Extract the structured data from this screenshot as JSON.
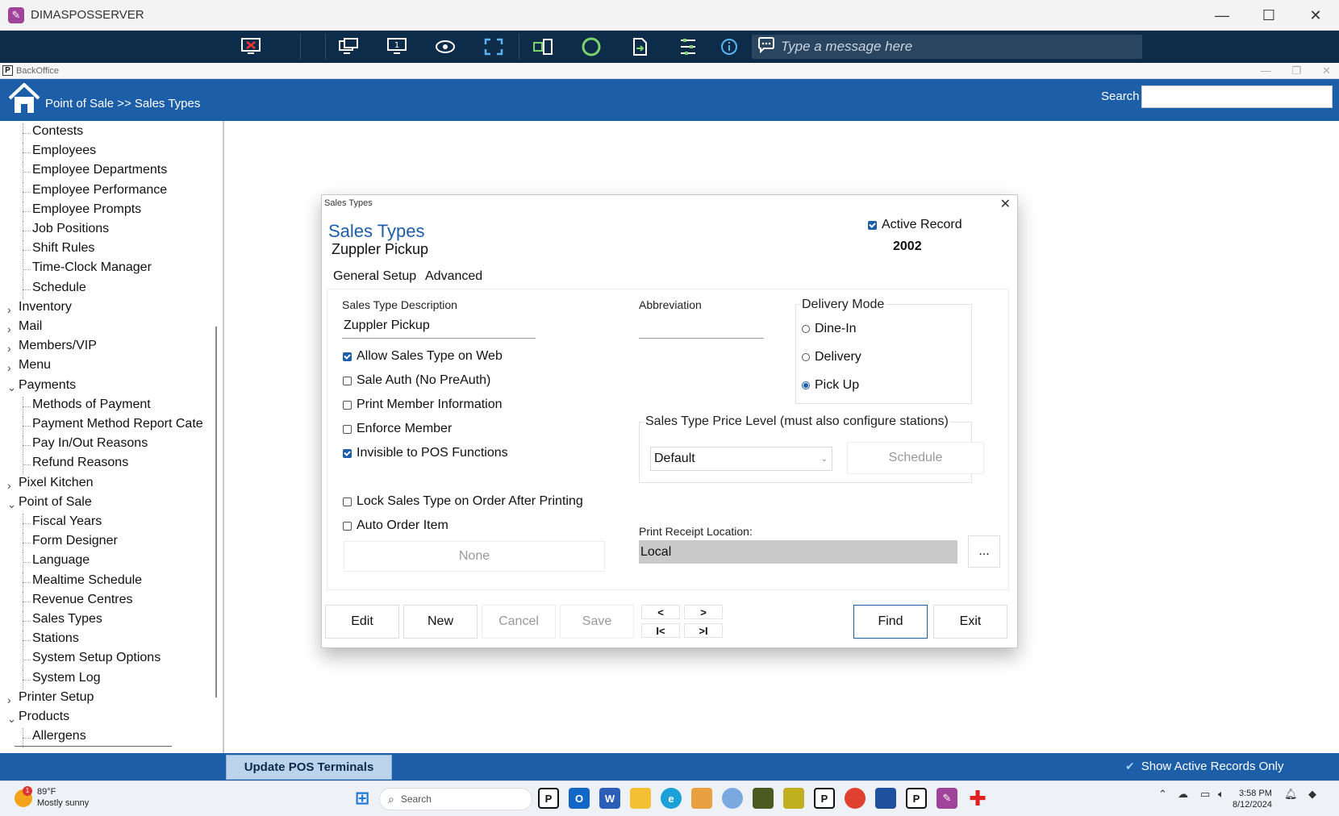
{
  "window": {
    "title": "DIMASPOSSERVER",
    "controls": [
      "—",
      "☐",
      "✕"
    ]
  },
  "remote_toolbar": {
    "icons": [
      "disconnect-icon",
      "monitor-swap-icon",
      "monitor-one-icon",
      "view-icon",
      "fullscreen-icon",
      "transfer-icon",
      "record-icon",
      "file-transfer-icon",
      "settings-list-icon",
      "info-icon"
    ],
    "message_placeholder": "Type a message here"
  },
  "backoffice_bar": {
    "title": "BackOffice",
    "logo": "P"
  },
  "header": {
    "breadcrumb": "Point of Sale >> Sales Types",
    "search_label": "Search",
    "search_value": ""
  },
  "sidebar": {
    "items": [
      {
        "label": "Contests",
        "level": 1
      },
      {
        "label": "Employees",
        "level": 1
      },
      {
        "label": "Employee Departments",
        "level": 1
      },
      {
        "label": "Employee Performance",
        "level": 1
      },
      {
        "label": "Employee Prompts",
        "level": 1
      },
      {
        "label": "Job Positions",
        "level": 1
      },
      {
        "label": "Shift Rules",
        "level": 1
      },
      {
        "label": "Time-Clock Manager",
        "level": 1
      },
      {
        "label": "Schedule",
        "level": 1
      },
      {
        "label": "Inventory",
        "level": 0,
        "expand": ">"
      },
      {
        "label": "Mail",
        "level": 0,
        "expand": ">"
      },
      {
        "label": "Members/VIP",
        "level": 0,
        "expand": ">"
      },
      {
        "label": "Menu",
        "level": 0,
        "expand": ">"
      },
      {
        "label": "Payments",
        "level": 0,
        "expand": "v"
      },
      {
        "label": "Methods of Payment",
        "level": 1
      },
      {
        "label": "Payment Method Report Cate",
        "level": 1
      },
      {
        "label": "Pay In/Out Reasons",
        "level": 1
      },
      {
        "label": "Refund Reasons",
        "level": 1
      },
      {
        "label": "Pixel Kitchen",
        "level": 0,
        "expand": ">"
      },
      {
        "label": "Point of Sale",
        "level": 0,
        "expand": "v"
      },
      {
        "label": "Fiscal Years",
        "level": 1
      },
      {
        "label": "Form Designer",
        "level": 1
      },
      {
        "label": "Language",
        "level": 1
      },
      {
        "label": "Mealtime Schedule",
        "level": 1
      },
      {
        "label": "Revenue Centres",
        "level": 1
      },
      {
        "label": "Sales Types",
        "level": 1
      },
      {
        "label": "Stations",
        "level": 1
      },
      {
        "label": "System Setup Options",
        "level": 1
      },
      {
        "label": "System Log",
        "level": 1
      },
      {
        "label": "Printer Setup",
        "level": 0,
        "expand": ">"
      },
      {
        "label": "Products",
        "level": 0,
        "expand": "v"
      },
      {
        "label": "Allergens",
        "level": 1
      }
    ]
  },
  "dialog": {
    "window_title": "Sales Types",
    "heading": "Sales Types",
    "record_name": "Zuppler Pickup",
    "active_record_label": "Active Record",
    "active_record_checked": true,
    "record_id": "2002",
    "tabs": [
      "General Setup",
      "Advanced"
    ],
    "description_label": "Sales Type Description",
    "description_value": "Zuppler Pickup",
    "abbreviation_label": "Abbreviation",
    "abbreviation_value": "",
    "checkboxes": [
      {
        "label": "Allow Sales Type on Web",
        "checked": true
      },
      {
        "label": "Sale Auth (No PreAuth)",
        "checked": false
      },
      {
        "label": "Print Member Information",
        "checked": false
      },
      {
        "label": "Enforce Member",
        "checked": false
      },
      {
        "label": "Invisible to POS Functions",
        "checked": true
      },
      {
        "label": "Lock Sales Type on Order After Printing",
        "checked": false
      },
      {
        "label": "Auto Order Item",
        "checked": false
      }
    ],
    "auto_order_item_value": "None",
    "delivery_mode": {
      "title": "Delivery Mode",
      "options": [
        "Dine-In",
        "Delivery",
        "Pick Up"
      ],
      "selected": "Pick Up"
    },
    "price_level": {
      "title": "Sales Type Price Level (must also configure stations)",
      "selected": "Default",
      "schedule_button": "Schedule"
    },
    "print_receipt": {
      "label": "Print Receipt Location:",
      "value": "Local",
      "browse_button": "..."
    },
    "buttons": {
      "edit": "Edit",
      "new": "New",
      "cancel": "Cancel",
      "save": "Save",
      "prev": "<",
      "next": ">",
      "first": "I<",
      "last": ">I",
      "find": "Find",
      "exit": "Exit"
    }
  },
  "bottom_bar": {
    "update_button": "Update POS Terminals",
    "show_active_label": "Show Active Records Only",
    "show_active_checked": true
  },
  "taskbar": {
    "weather_temp": "89°F",
    "weather_desc": "Mostly sunny",
    "weather_badge": "1",
    "search_label": "Search",
    "time": "3:58 PM",
    "date": "8/12/2024"
  },
  "colors": {
    "brand_blue": "#1d5ea8",
    "toolbar_dark": "#0c2c4a",
    "button_highlight": "#bcd3ec"
  }
}
